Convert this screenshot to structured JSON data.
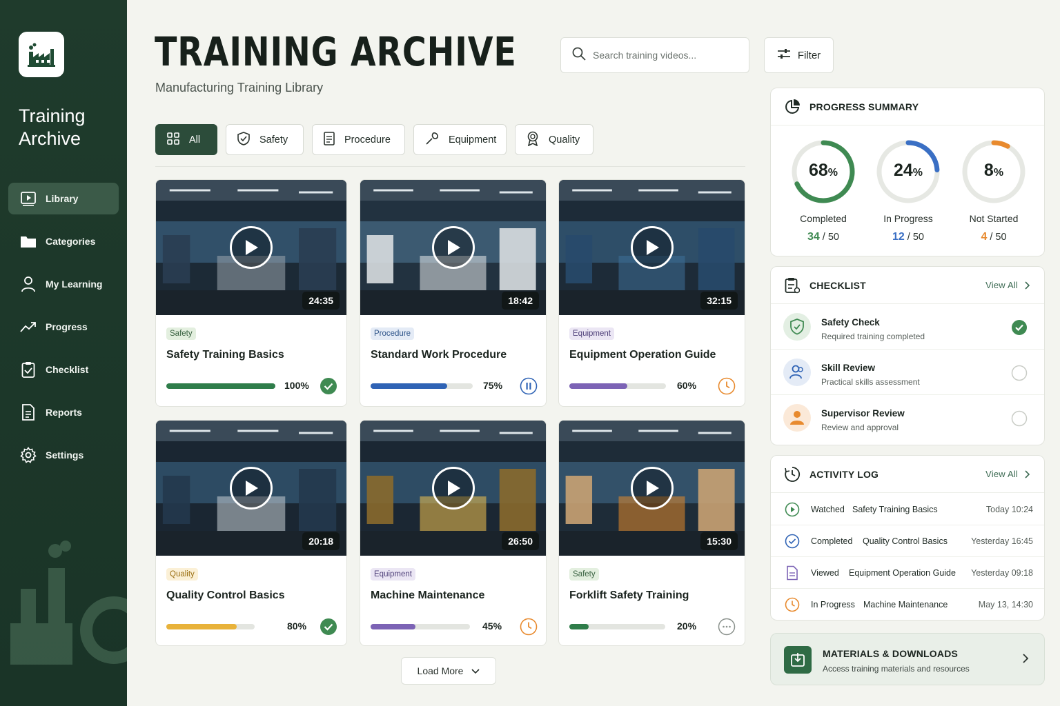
{
  "sidebar": {
    "title_line1": "Training",
    "title_line2": "Archive",
    "items": [
      {
        "label": "Library",
        "icon": "play-screen-icon"
      },
      {
        "label": "Categories",
        "icon": "folder-icon"
      },
      {
        "label": "My Learning",
        "icon": "user-icon"
      },
      {
        "label": "Progress",
        "icon": "trend-icon"
      },
      {
        "label": "Checklist",
        "icon": "clipboard-check-icon"
      },
      {
        "label": "Reports",
        "icon": "document-icon"
      },
      {
        "label": "Settings",
        "icon": "gear-icon"
      }
    ]
  },
  "header": {
    "title": "TRAINING ARCHIVE",
    "subtitle": "Manufacturing Training Library",
    "search_placeholder": "Search training videos...",
    "filter_label": "Filter"
  },
  "tabs": [
    {
      "label": "All",
      "icon": "grid-icon"
    },
    {
      "label": "Safety",
      "icon": "shield-icon"
    },
    {
      "label": "Procedure",
      "icon": "document-icon"
    },
    {
      "label": "Equipment",
      "icon": "wrench-icon"
    },
    {
      "label": "Quality",
      "icon": "badge-icon"
    }
  ],
  "videos": [
    {
      "duration": "24:35",
      "category": "Safety",
      "title": "Safety Training Basics",
      "progress_pct": 100,
      "progress_label": "100%",
      "status": "completed",
      "color": "#2f7d4a"
    },
    {
      "duration": "18:42",
      "category": "Procedure",
      "title": "Standard Work Procedure",
      "progress_pct": 75,
      "progress_label": "75%",
      "status": "paused",
      "color": "#2f63b5"
    },
    {
      "duration": "32:15",
      "category": "Equipment",
      "title": "Equipment Operation Guide",
      "progress_pct": 60,
      "progress_label": "60%",
      "status": "in-progress",
      "color": "#7c63b5"
    },
    {
      "duration": "20:18",
      "category": "Quality",
      "title": "Quality Control Basics",
      "progress_pct": 80,
      "progress_label": "80%",
      "status": "completed",
      "color": "#e8b23a"
    },
    {
      "duration": "26:50",
      "category": "Equipment",
      "title": "Machine Maintenance",
      "progress_pct": 45,
      "progress_label": "45%",
      "status": "in-progress",
      "color": "#7c63b5"
    },
    {
      "duration": "15:30",
      "category": "Safety",
      "title": "Forklift Safety Training",
      "progress_pct": 20,
      "progress_label": "20%",
      "status": "not-started",
      "color": "#2f7d4a"
    }
  ],
  "load_more": "Load More",
  "progress_summary": {
    "title": "PROGRESS SUMMARY",
    "rings": [
      {
        "pct": "68",
        "unit": "%",
        "value": 0.68,
        "label": "Completed",
        "count": "34",
        "total": " / 50",
        "color": "#3f8a52"
      },
      {
        "pct": "24",
        "unit": "%",
        "value": 0.24,
        "label": "In Progress",
        "count": "12",
        "total": " / 50",
        "color": "#3a6fc4"
      },
      {
        "pct": "8",
        "unit": "%",
        "value": 0.08,
        "label": "Not Started",
        "count": "4",
        "total": " / 50",
        "color": "#e88a2e"
      }
    ]
  },
  "checklist": {
    "title": "CHECKLIST",
    "view_all": "View All",
    "items": [
      {
        "title": "Safety Check",
        "subtitle": "Required training completed",
        "done": true
      },
      {
        "title": "Skill Review",
        "subtitle": "Practical skills assessment",
        "done": false
      },
      {
        "title": "Supervisor Review",
        "subtitle": "Review and approval",
        "done": false
      }
    ]
  },
  "activity": {
    "title": "ACTIVITY LOG",
    "view_all": "View All",
    "items": [
      {
        "action": "Watched",
        "target": "Safety Training Basics",
        "time": "Today 10:24"
      },
      {
        "action": "Completed",
        "target": "Quality Control Basics",
        "time": "Yesterday 16:45"
      },
      {
        "action": "Viewed",
        "target": "Equipment Operation Guide",
        "time": "Yesterday 09:18"
      },
      {
        "action": "In Progress",
        "target": "Machine Maintenance",
        "time": "May 13, 14:30"
      }
    ]
  },
  "materials": {
    "title": "MATERIALS & DOWNLOADS",
    "subtitle": "Access training materials and resources"
  }
}
